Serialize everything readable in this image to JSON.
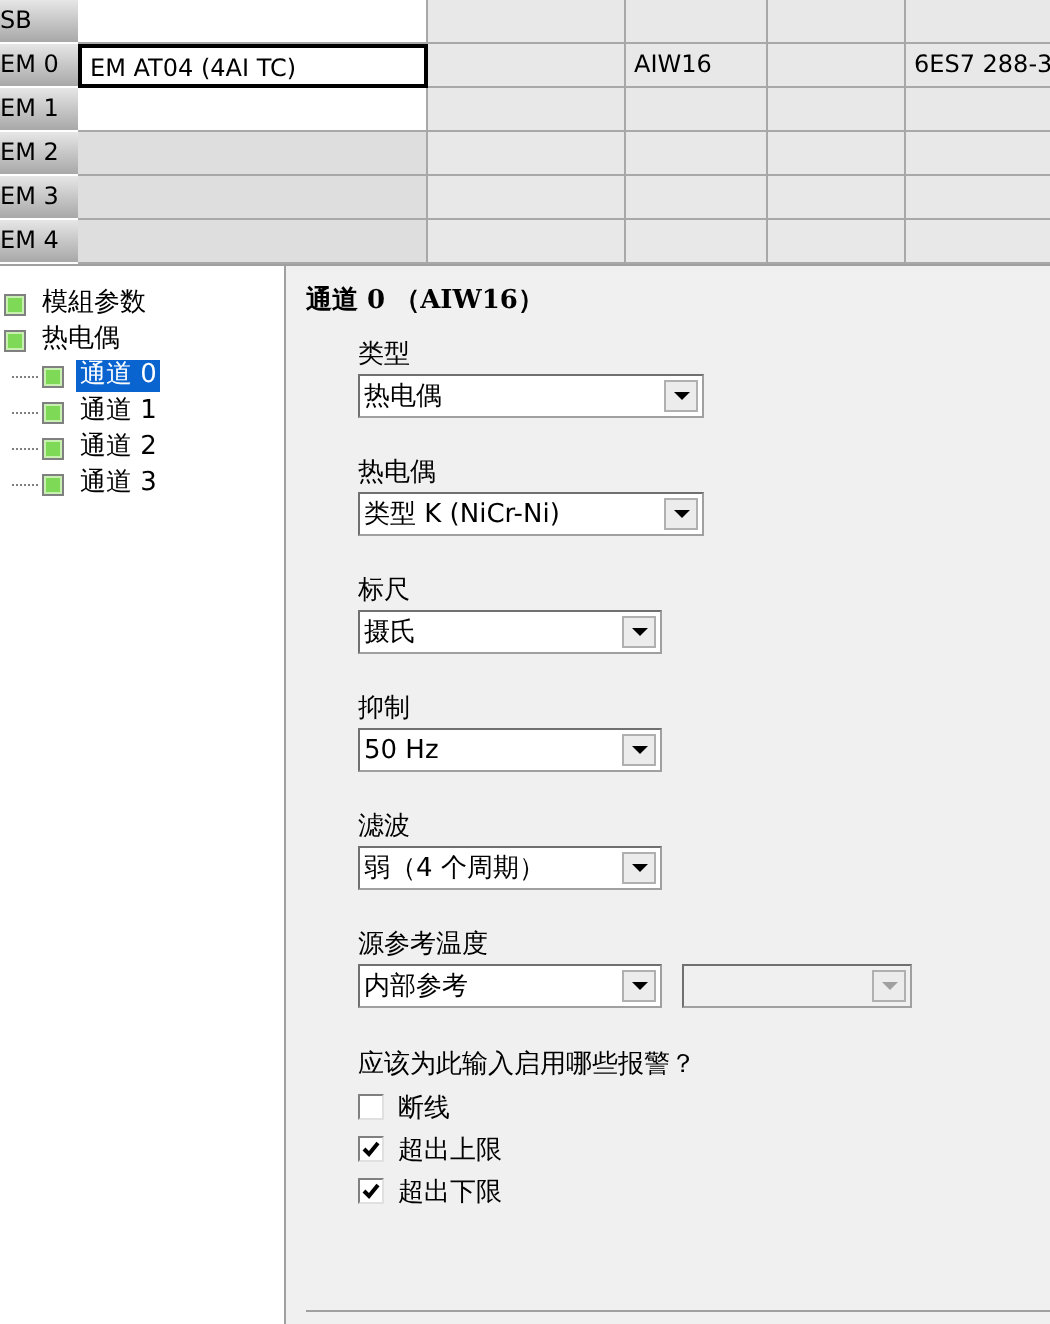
{
  "grid": {
    "rows": [
      {
        "header": "SB",
        "editable": true,
        "selected": false
      },
      {
        "header": "EM 0",
        "editable": true,
        "selected": true,
        "column_1": "EM AT04 (4AI TC)",
        "column_3": "AIW16",
        "column_5": "6ES7 288-3"
      },
      {
        "header": "EM 1",
        "editable": true,
        "selected": false
      },
      {
        "header": "EM 2",
        "editable": false,
        "selected": false
      },
      {
        "header": "EM 3",
        "editable": false,
        "selected": false
      },
      {
        "header": "EM 4",
        "editable": false,
        "selected": false
      }
    ]
  },
  "tree": {
    "items": [
      {
        "label": "模組参数",
        "selected": false
      },
      {
        "label": "热电偶",
        "selected": false,
        "children": [
          {
            "label": "通道 0",
            "selected": true
          },
          {
            "label": "通道 1",
            "selected": false
          },
          {
            "label": "通道 2",
            "selected": false
          },
          {
            "label": "通道 3",
            "selected": false
          }
        ]
      }
    ]
  },
  "panel": {
    "title": "通道 0 （AIW16）",
    "fields": [
      {
        "label": "类型",
        "dropdowns": [
          {
            "value": "热电偶",
            "disabled": false
          }
        ]
      },
      {
        "label": "热电偶",
        "dropdowns": [
          {
            "value": "类型 K (NiCr-Ni)",
            "disabled": false
          }
        ]
      },
      {
        "label": "标尺",
        "dropdowns": [
          {
            "value": "摄氏",
            "disabled": false
          }
        ]
      },
      {
        "label": "抑制",
        "dropdowns": [
          {
            "value": "50 Hz",
            "disabled": false
          }
        ]
      },
      {
        "label": "滤波",
        "dropdowns": [
          {
            "value": "弱（4 个周期）",
            "disabled": false
          }
        ]
      },
      {
        "label": "源参考温度",
        "dropdowns": [
          {
            "value": "内部参考",
            "disabled": false
          },
          {
            "disabled": true
          }
        ]
      }
    ],
    "alarms_question": "应该为此输入启用哪些报警？",
    "alarms": [
      {
        "label": "断线",
        "checked": false
      },
      {
        "label": "超出上限",
        "checked": true
      },
      {
        "label": "超出下限",
        "checked": true
      }
    ]
  }
}
